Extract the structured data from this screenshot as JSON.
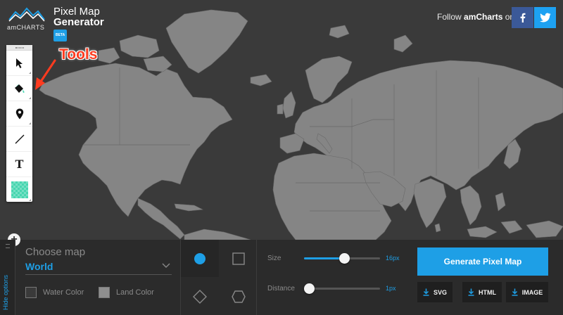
{
  "header": {
    "logo_text": "amCHARTS",
    "product_line1": "Pixel Map",
    "product_line2": "Generator",
    "beta_badge": "BETA",
    "follow_prefix": "Follow ",
    "follow_brand": "amCharts",
    "follow_suffix": " on:",
    "social": [
      {
        "name": "facebook",
        "icon": "f",
        "color": "#3b5998"
      },
      {
        "name": "twitter",
        "icon": "twitter-bird",
        "color": "#1da1f2"
      }
    ]
  },
  "annotation": {
    "tools_label": "Tools",
    "color": "#ff3b1f"
  },
  "toolbar": {
    "tools": [
      {
        "name": "select",
        "icon": "cursor-arrow-icon"
      },
      {
        "name": "paint",
        "icon": "paint-bucket-icon"
      },
      {
        "name": "marker",
        "icon": "map-pin-icon"
      },
      {
        "name": "line",
        "icon": "line-icon"
      },
      {
        "name": "text",
        "icon": "text-icon",
        "glyph": "T"
      },
      {
        "name": "color",
        "icon": "color-swatch-icon",
        "color": "#47d6b0"
      }
    ]
  },
  "panel": {
    "hide_options": "Hide options",
    "choose_map_label": "Choose map",
    "selected_map": "World",
    "water_color_label": "Water Color",
    "land_color_label": "Land Color",
    "water_color": "#3a3a3a",
    "land_color": "#8e8e8e",
    "shapes": [
      "circle",
      "square",
      "diamond",
      "hexagon"
    ],
    "selected_shape": "circle",
    "size": {
      "label": "Size",
      "value": "16px",
      "fraction": 0.53
    },
    "distance": {
      "label": "Distance",
      "value": "1px",
      "fraction": 0.0
    },
    "generate_label": "Generate Pixel Map",
    "downloads": [
      {
        "label": "SVG"
      },
      {
        "label": "HTML"
      },
      {
        "label": "IMAGE"
      }
    ],
    "accent_color": "#1e9fe6"
  }
}
